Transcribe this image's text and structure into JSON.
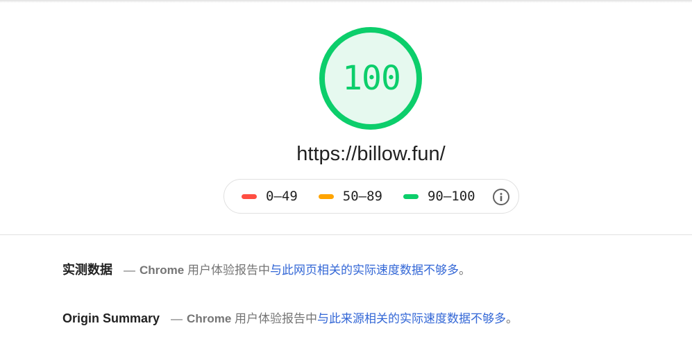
{
  "score": {
    "value": "100",
    "percent": 100,
    "color": "#0cce6b",
    "fill_color": "#e6f9ef"
  },
  "report": {
    "url": "https://billow.fun/"
  },
  "legend": {
    "items": [
      {
        "label": "0–49",
        "color": "#ff4e42"
      },
      {
        "label": "50–89",
        "color": "#ffa400"
      },
      {
        "label": "90–100",
        "color": "#0cce6b"
      }
    ],
    "info_icon": "info-icon"
  },
  "field_data": {
    "title": "实测数据",
    "dash": "—",
    "source_bold": "Chrome",
    "source_rest": " 用户体验报告中",
    "link_text": "与此网页相关的实际速度数据不够多",
    "tail": "。"
  },
  "origin_summary": {
    "title": "Origin Summary",
    "dash": "—",
    "source_bold": "Chrome",
    "source_rest": " 用户体验报告中",
    "link_text": "与此来源相关的实际速度数据不够多",
    "tail": "。"
  }
}
